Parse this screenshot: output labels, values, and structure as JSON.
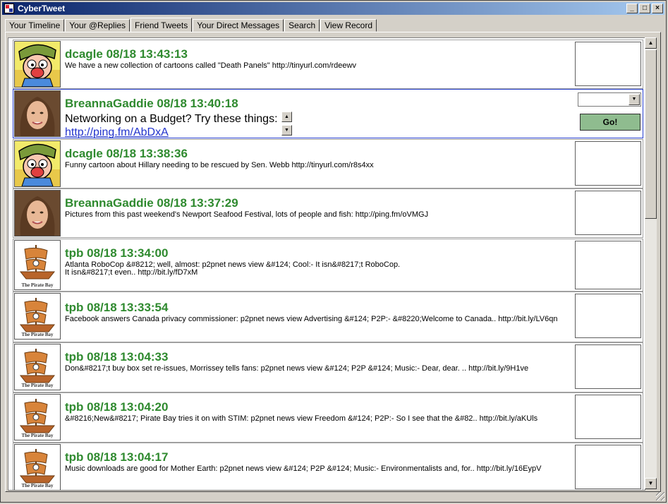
{
  "window": {
    "title": "CyberTweet"
  },
  "title_buttons": {
    "minimize": "_",
    "maximize": "□",
    "close": "×"
  },
  "tabs": [
    {
      "label": "Your Timeline"
    },
    {
      "label": "Your @Replies"
    },
    {
      "label": "Friend Tweets",
      "active": true
    },
    {
      "label": "Your Direct Messages"
    },
    {
      "label": "Search"
    },
    {
      "label": "View Record"
    }
  ],
  "selected": {
    "user": "BreannaGaddie",
    "head": "BreannaGaddie 08/18 13:40:18",
    "text": "Networking on a Budget? Try these things:",
    "link": "http://ping.fm/AbDxA",
    "go_label": "Go!",
    "combo_value": ""
  },
  "tweets": [
    {
      "user": "dcagle",
      "head": "dcagle 08/18 13:43:13",
      "text": "We have a new collection of cartoons called \"Death Panels\" http://tinyurl.com/rdeewv",
      "avatar": "cartoon"
    },
    {
      "user": "dcagle",
      "head": "dcagle 08/18 13:38:36",
      "text": "Funny cartoon about Hillary needing to be rescued by Sen. Webb http://tinyurl.com/r8s4xx",
      "avatar": "cartoon"
    },
    {
      "user": "BreannaGaddie",
      "head": "BreannaGaddie 08/18 13:37:29",
      "text": "Pictures from this past weekend's Newport Seafood Festival, lots of people and fish: http://ping.fm/oVMGJ",
      "avatar": "portrait"
    },
    {
      "user": "tpb",
      "head": "tpb 08/18 13:34:00",
      "text": "Atlanta RoboCop &#8212; well, almost: p2pnet news view &#124; Cool:- It isn&#8217;t RoboCop.",
      "text2": "It isn&#8217;t even.. http://bit.ly/fD7xM",
      "avatar": "pirate"
    },
    {
      "user": "tpb",
      "head": "tpb 08/18 13:33:54",
      "text": "Facebook answers Canada privacy commissioner: p2pnet news view Advertising &#124; P2P:- &#8220;Welcome to Canada.. http://bit.ly/LV6qn",
      "avatar": "pirate"
    },
    {
      "user": "tpb",
      "head": "tpb 08/18 13:04:33",
      "text": "Don&#8217;t buy box set re-issues, Morrissey tells fans: p2pnet news view &#124; P2P &#124; Music:- Dear, dear. .. http://bit.ly/9H1ve",
      "avatar": "pirate"
    },
    {
      "user": "tpb",
      "head": "tpb 08/18 13:04:20",
      "text": "&#8216;New&#8217; Pirate Bay tries it on with STIM: p2pnet news view Freedom &#124; P2P:- So I see that the &#82.. http://bit.ly/aKUls",
      "avatar": "pirate"
    },
    {
      "user": "tpb",
      "head": "tpb 08/18 13:04:17",
      "text": "Music downloads are good for Mother Earth: p2pnet news view &#124; P2P &#124; Music:- Environmentalists and, for.. http://bit.ly/16EypV",
      "avatar": "pirate"
    }
  ],
  "avatar_captions": {
    "pirate": "The Pirate Bay"
  },
  "scrollbar": {
    "up": "▲",
    "down": "▼"
  }
}
